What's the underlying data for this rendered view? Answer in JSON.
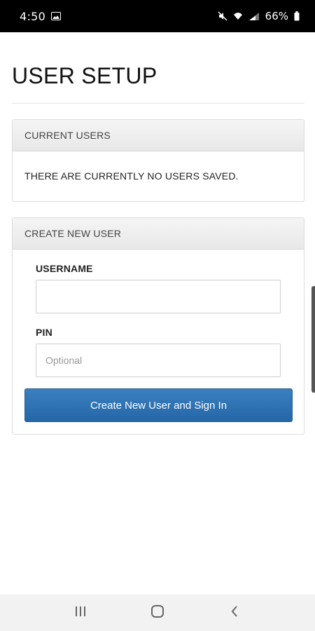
{
  "status_bar": {
    "time": "4:50",
    "battery_text": "66%",
    "icons": [
      "image-icon",
      "mute-icon",
      "wifi-icon",
      "signal-icon",
      "battery-icon"
    ]
  },
  "page": {
    "title": "USER SETUP"
  },
  "current_users": {
    "heading": "CURRENT USERS",
    "empty_message": "THERE ARE CURRENTLY NO USERS SAVED."
  },
  "create_user": {
    "heading": "CREATE NEW USER",
    "username_label": "USERNAME",
    "username_value": "",
    "pin_label": "PIN",
    "pin_placeholder": "Optional",
    "submit_label": "Create New User and Sign In"
  },
  "nav_bar": {
    "buttons": [
      "recents-icon",
      "home-icon",
      "back-icon"
    ]
  },
  "colors": {
    "primary_button": "#2f73b4",
    "panel_heading_bg": "#ececec",
    "status_bar_bg": "#000000"
  }
}
